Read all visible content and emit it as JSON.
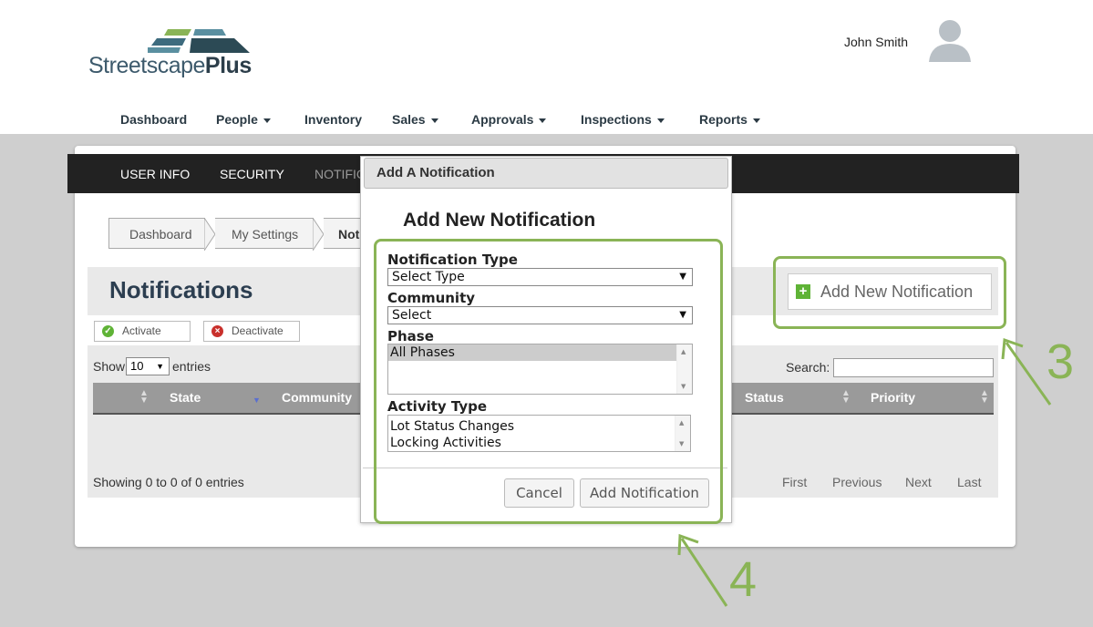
{
  "brand": {
    "name_light": "Streetscape",
    "name_bold": "Plus"
  },
  "user": {
    "name": "John Smith"
  },
  "nav": [
    {
      "label": "Dashboard",
      "dropdown": false
    },
    {
      "label": "People",
      "dropdown": true
    },
    {
      "label": "Inventory",
      "dropdown": false
    },
    {
      "label": "Sales",
      "dropdown": true
    },
    {
      "label": "Approvals",
      "dropdown": true
    },
    {
      "label": "Inspections",
      "dropdown": true
    },
    {
      "label": "Reports",
      "dropdown": true
    }
  ],
  "settings_tabs": [
    "USER INFO",
    "SECURITY",
    "NOTIFIC"
  ],
  "breadcrumb": [
    "Dashboard",
    "My Settings",
    "Not"
  ],
  "page": {
    "title": "Notifications",
    "activate_label": "Activate",
    "deactivate_label": "Deactivate",
    "add_new_label": "Add New Notification"
  },
  "table": {
    "show_label": "Show",
    "entries_value": "10",
    "entries_label": "entries",
    "search_label": "Search:",
    "columns": [
      "State",
      "Community",
      "Status",
      "Priority"
    ],
    "info": "Showing 0 to 0 of 0 entries",
    "pager": [
      "First",
      "Previous",
      "Next",
      "Last"
    ]
  },
  "modal": {
    "header": "Add A Notification",
    "title": "Add New Notification",
    "notification_type_label": "Notification Type",
    "notification_type_value": "Select Type",
    "community_label": "Community",
    "community_value": "Select",
    "phase_label": "Phase",
    "phase_options": [
      "All Phases"
    ],
    "activity_type_label": "Activity Type",
    "activity_options": [
      "Lot Status Changes",
      "Locking Activities"
    ],
    "cancel_label": "Cancel",
    "submit_label": "Add Notification"
  },
  "annotations": {
    "step_3": "3",
    "step_4": "4"
  },
  "colors": {
    "accent_green": "#8ab456",
    "tab_bar": "#222222",
    "title": "#2c3e50"
  }
}
